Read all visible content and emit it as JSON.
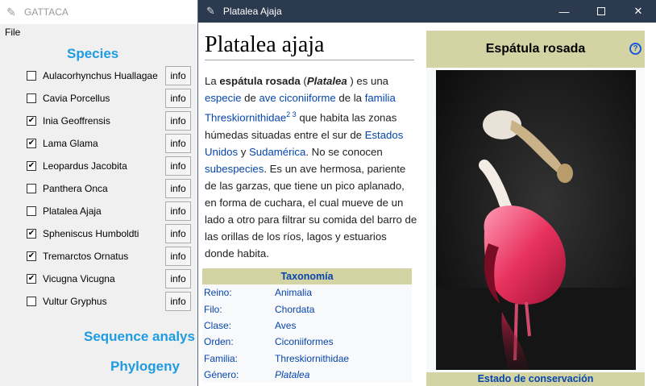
{
  "main_window": {
    "title": "GATTACA",
    "menu": [
      "File"
    ],
    "species_title": "Species",
    "species": [
      {
        "name": "Aulacorhynchus Huallagae",
        "checked": false
      },
      {
        "name": "Cavia Porcellus",
        "checked": false
      },
      {
        "name": "Inia Geoffrensis",
        "checked": true
      },
      {
        "name": "Lama Glama",
        "checked": true
      },
      {
        "name": "Leopardus Jacobita",
        "checked": true
      },
      {
        "name": "Panthera Onca",
        "checked": false
      },
      {
        "name": "Platalea Ajaja",
        "checked": false
      },
      {
        "name": "Spheniscus Humboldti",
        "checked": true
      },
      {
        "name": "Tremarctos Ornatus",
        "checked": true
      },
      {
        "name": "Vicugna Vicugna",
        "checked": true
      },
      {
        "name": "Vultur Gryphus",
        "checked": false
      }
    ],
    "info_label": "info",
    "sequence_title": "Sequence analys",
    "phylogeny_title": "Phylogeny"
  },
  "doc_window": {
    "title": "Platalea Ajaja",
    "article_title": "Platalea ajaja",
    "intro": {
      "p1": "La ",
      "common_name": "espátula rosada",
      "p2": " (",
      "genus": "Platalea",
      "p3": " ) es una ",
      "l_especie": "especie",
      "p4": " de ",
      "l_ave": "ave ciconiiforme",
      "p5": " de la ",
      "l_familia": "familia",
      "l_thresk": "Threskiornithidae",
      "refs": "2 3",
      "p6": "  que habita las zonas húmedas situadas entre el sur de ",
      "l_eeuu": "Estados Unidos",
      "p7": " y ",
      "l_sudamerica": "Sudamérica",
      "p8": ". No se conocen ",
      "l_subespecies": "subespecies",
      "p9": ". Es un ave hermosa, pariente de las garzas, que tiene un pico aplanado, en forma de cuchara, el cual mueve de un lado a otro para filtrar su comida del barro de las orillas de los ríos, lagos y estuarios donde habita."
    },
    "taxonomy": {
      "header": "Taxonomía",
      "rows": [
        {
          "k": "Reino:",
          "v": "Animalia"
        },
        {
          "k": "Filo:",
          "v": "Chordata"
        },
        {
          "k": "Clase:",
          "v": "Aves"
        },
        {
          "k": "Orden:",
          "v": "Ciconiiformes"
        },
        {
          "k": "Familia:",
          "v": "Threskiornithidae"
        },
        {
          "k": "Género:",
          "v": "Platalea"
        }
      ]
    },
    "infobox": {
      "title": "Espátula rosada",
      "help": "?",
      "conservation_header": "Estado de conservación"
    }
  },
  "colors": {
    "section_title": "#1f9be0",
    "link": "#0645ad",
    "infobox_band": "#d3d3a4",
    "titlebar": "#2b3a4f"
  },
  "icons": [
    "feather-icon",
    "minimize-icon",
    "maximize-icon",
    "close-icon",
    "help-icon"
  ]
}
